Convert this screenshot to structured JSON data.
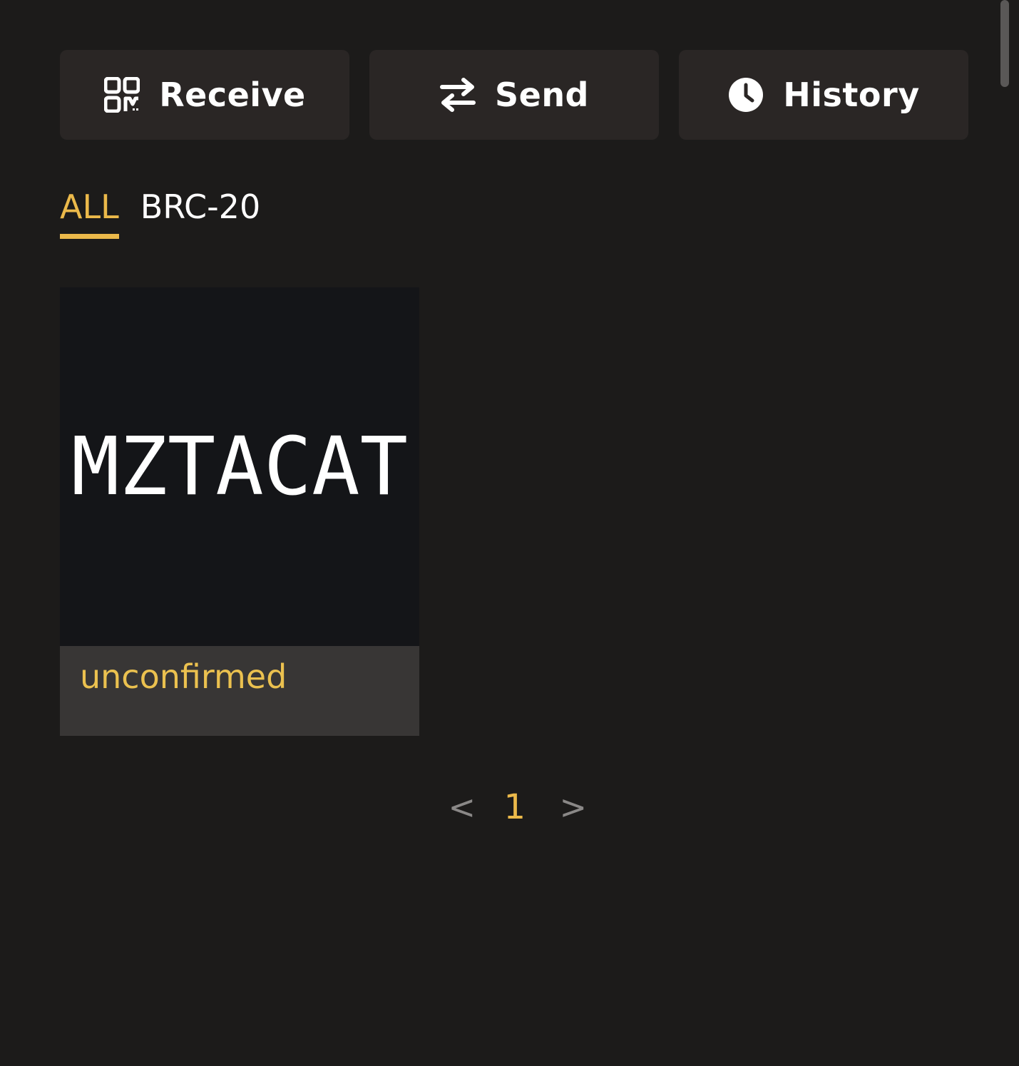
{
  "actions": {
    "receive": {
      "label": "Receive",
      "icon": "qr-code-icon"
    },
    "send": {
      "label": "Send",
      "icon": "swap-arrows-icon"
    },
    "history": {
      "label": "History",
      "icon": "clock-icon"
    }
  },
  "tabs": [
    {
      "label": "ALL",
      "active": true
    },
    {
      "label": "BRC-20",
      "active": false
    }
  ],
  "inscriptions": [
    {
      "preview_text": "MZTACAT",
      "status": "unconfirmed"
    }
  ],
  "pagination": {
    "prev": "<",
    "current": "1",
    "next": ">"
  },
  "colors": {
    "background": "#1c1b1a",
    "button": "#2a2625",
    "accent": "#ebb94a",
    "card_preview": "#141518",
    "card_footer": "#383635"
  }
}
